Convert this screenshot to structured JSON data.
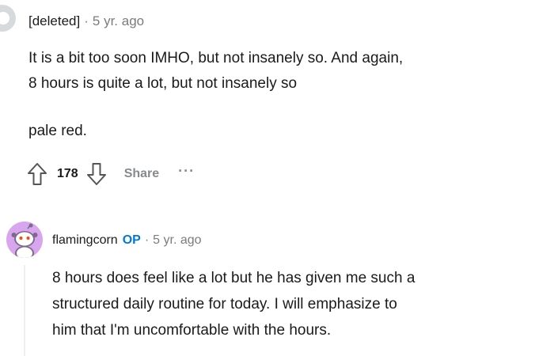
{
  "comments": [
    {
      "author": "[deleted]",
      "separator": "·",
      "timestamp": "5 yr. ago",
      "body_lines": [
        "It is a bit too soon IMHO, but not insanely so. And again,",
        "8 hours is quite a lot, but not insanely so"
      ],
      "body_para2": "pale red.",
      "votes": "178",
      "share_label": "Share",
      "more_label": "···",
      "avatar_icon": "deleted-user-avatar-icon"
    },
    {
      "author": "flamingcorn",
      "op_badge": "OP",
      "separator": "·",
      "timestamp": "5 yr. ago",
      "body_lines": [
        "8 hours does feel like a lot but he has given me such a",
        "structured daily routine for today. I will emphasize to",
        "him that I'm uncomfortable with the hours."
      ],
      "avatar_icon": "snoo-avatar-icon"
    }
  ],
  "colors": {
    "avatar_deleted": "#d7dadc",
    "avatar_op": "#d8a6ee",
    "op_badge": "#0079d3",
    "muted": "#878a8c"
  }
}
